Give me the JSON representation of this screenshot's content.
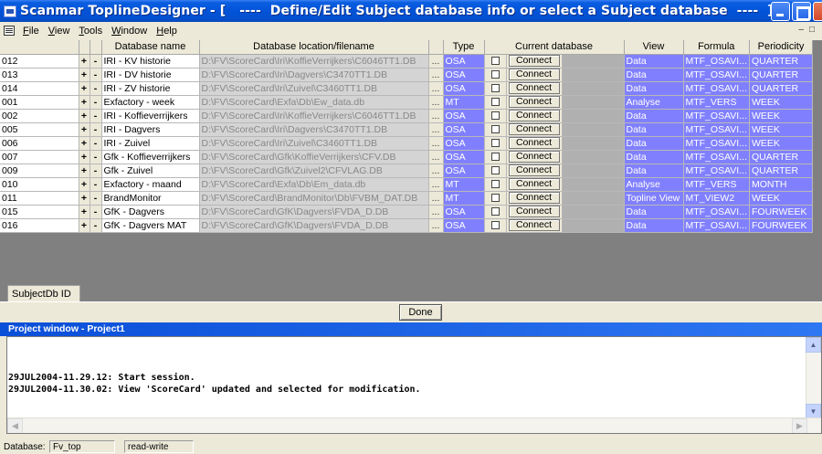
{
  "window": {
    "title": "Scanmar ToplineDesigner - [   ----  Define/Edit Subject database info or select a Subject database  ----  ]"
  },
  "menu": [
    {
      "label": "File",
      "ul": "F",
      "rest": "ile"
    },
    {
      "label": "View",
      "ul": "V",
      "rest": "iew"
    },
    {
      "label": "Tools",
      "ul": "T",
      "rest": "ools"
    },
    {
      "label": "Window",
      "ul": "W",
      "rest": "indow"
    },
    {
      "label": "Help",
      "ul": "H",
      "rest": "elp"
    }
  ],
  "grid": {
    "headers": {
      "name": "Database name",
      "location": "Database location/filename",
      "type": "Type",
      "current": "Current database",
      "view": "View",
      "formula": "Formula",
      "periodicity": "Periodicity"
    },
    "plus_label": "+",
    "minus_label": "-",
    "browse_label": "...",
    "connect_label": "Connect",
    "rows": [
      {
        "id": "012",
        "name": "IRI - KV historie",
        "location": "D:\\FV\\ScoreCard\\Iri\\KoffieVerrijkers\\C6046TT1.DB",
        "type": "OSA",
        "view": "Data",
        "formula": "MTF_OSAVI...",
        "periodicity": "QUARTER"
      },
      {
        "id": "013",
        "name": "IRI - DV historie",
        "location": "D:\\FV\\ScoreCard\\Iri\\Dagvers\\C3470TT1.DB",
        "type": "OSA",
        "view": "Data",
        "formula": "MTF_OSAVI...",
        "periodicity": "QUARTER"
      },
      {
        "id": "014",
        "name": "IRI - ZV historie",
        "location": "D:\\FV\\ScoreCard\\Iri\\Zuivel\\C3460TT1.DB",
        "type": "OSA",
        "view": "Data",
        "formula": "MTF_OSAVI...",
        "periodicity": "QUARTER"
      },
      {
        "id": "001",
        "name": "Exfactory - week",
        "location": "D:\\FV\\ScoreCard\\Exfa\\Db\\Ew_data.db",
        "type": "MT",
        "view": "Analyse",
        "formula": "MTF_VERS",
        "periodicity": "WEEK"
      },
      {
        "id": "002",
        "name": "IRI - Koffieverrijkers",
        "location": "D:\\FV\\ScoreCard\\Iri\\KoffieVerrijkers\\C6046TT1.DB",
        "type": "OSA",
        "view": "Data",
        "formula": "MTF_OSAVI...",
        "periodicity": "WEEK"
      },
      {
        "id": "005",
        "name": "IRI - Dagvers",
        "location": "D:\\FV\\ScoreCard\\Iri\\Dagvers\\C3470TT1.DB",
        "type": "OSA",
        "view": "Data",
        "formula": "MTF_OSAVI...",
        "periodicity": "WEEK"
      },
      {
        "id": "006",
        "name": "IRI - Zuivel",
        "location": "D:\\FV\\ScoreCard\\Iri\\Zuivel\\C3460TT1.DB",
        "type": "OSA",
        "view": "Data",
        "formula": "MTF_OSAVI...",
        "periodicity": "WEEK"
      },
      {
        "id": "007",
        "name": "Gfk - Koffieverrijkers",
        "location": "D:\\FV\\ScoreCard\\Gfk\\KoffieVerrijkers\\CFV.DB",
        "type": "OSA",
        "view": "Data",
        "formula": "MTF_OSAVI...",
        "periodicity": "QUARTER"
      },
      {
        "id": "009",
        "name": "Gfk - Zuivel",
        "location": "D:\\FV\\ScoreCard\\Gfk\\Zuivel2\\CFVLAG.DB",
        "type": "OSA",
        "view": "Data",
        "formula": "MTF_OSAVI...",
        "periodicity": "QUARTER"
      },
      {
        "id": "010",
        "name": "Exfactory - maand",
        "location": "D:\\FV\\ScoreCard\\Exfa\\Db\\Em_data.db",
        "type": "MT",
        "view": "Analyse",
        "formula": "MTF_VERS",
        "periodicity": "MONTH"
      },
      {
        "id": "011",
        "name": "BrandMonitor",
        "location": "D:\\FV\\ScoreCard\\BrandMonitor\\Db\\FVBM_DAT.DB",
        "type": "MT",
        "view": "Topline View",
        "formula": "MT_VIEW2",
        "periodicity": "WEEK"
      },
      {
        "id": "015",
        "name": "GfK - Dagvers",
        "location": "D:\\FV\\ScoreCard\\GfK\\Dagvers\\FVDA_D.DB",
        "type": "OSA",
        "view": "Data",
        "formula": "MTF_OSAVI...",
        "periodicity": "FOURWEEK"
      },
      {
        "id": "016",
        "name": "GfK - Dagvers MAT",
        "location": "D:\\FV\\ScoreCard\\GfK\\Dagvers\\FVDA_D.DB",
        "type": "OSA",
        "view": "Data",
        "formula": "MTF_OSAVI...",
        "periodicity": "FOURWEEK"
      }
    ],
    "subjectdb_label": "SubjectDb ID"
  },
  "done_label": "Done",
  "project": {
    "title": "Project window - Project1",
    "log": [
      "29JUL2004-11.29.12: Start session.",
      "29JUL2004-11.30.02: View 'ScoreCard' updated and selected for modification."
    ]
  },
  "status": {
    "label": "Database:",
    "database": "Fv_top",
    "mode": "read-write"
  },
  "colors": {
    "accent_blue": "#8080ff",
    "title_blue": "#0353d8"
  }
}
